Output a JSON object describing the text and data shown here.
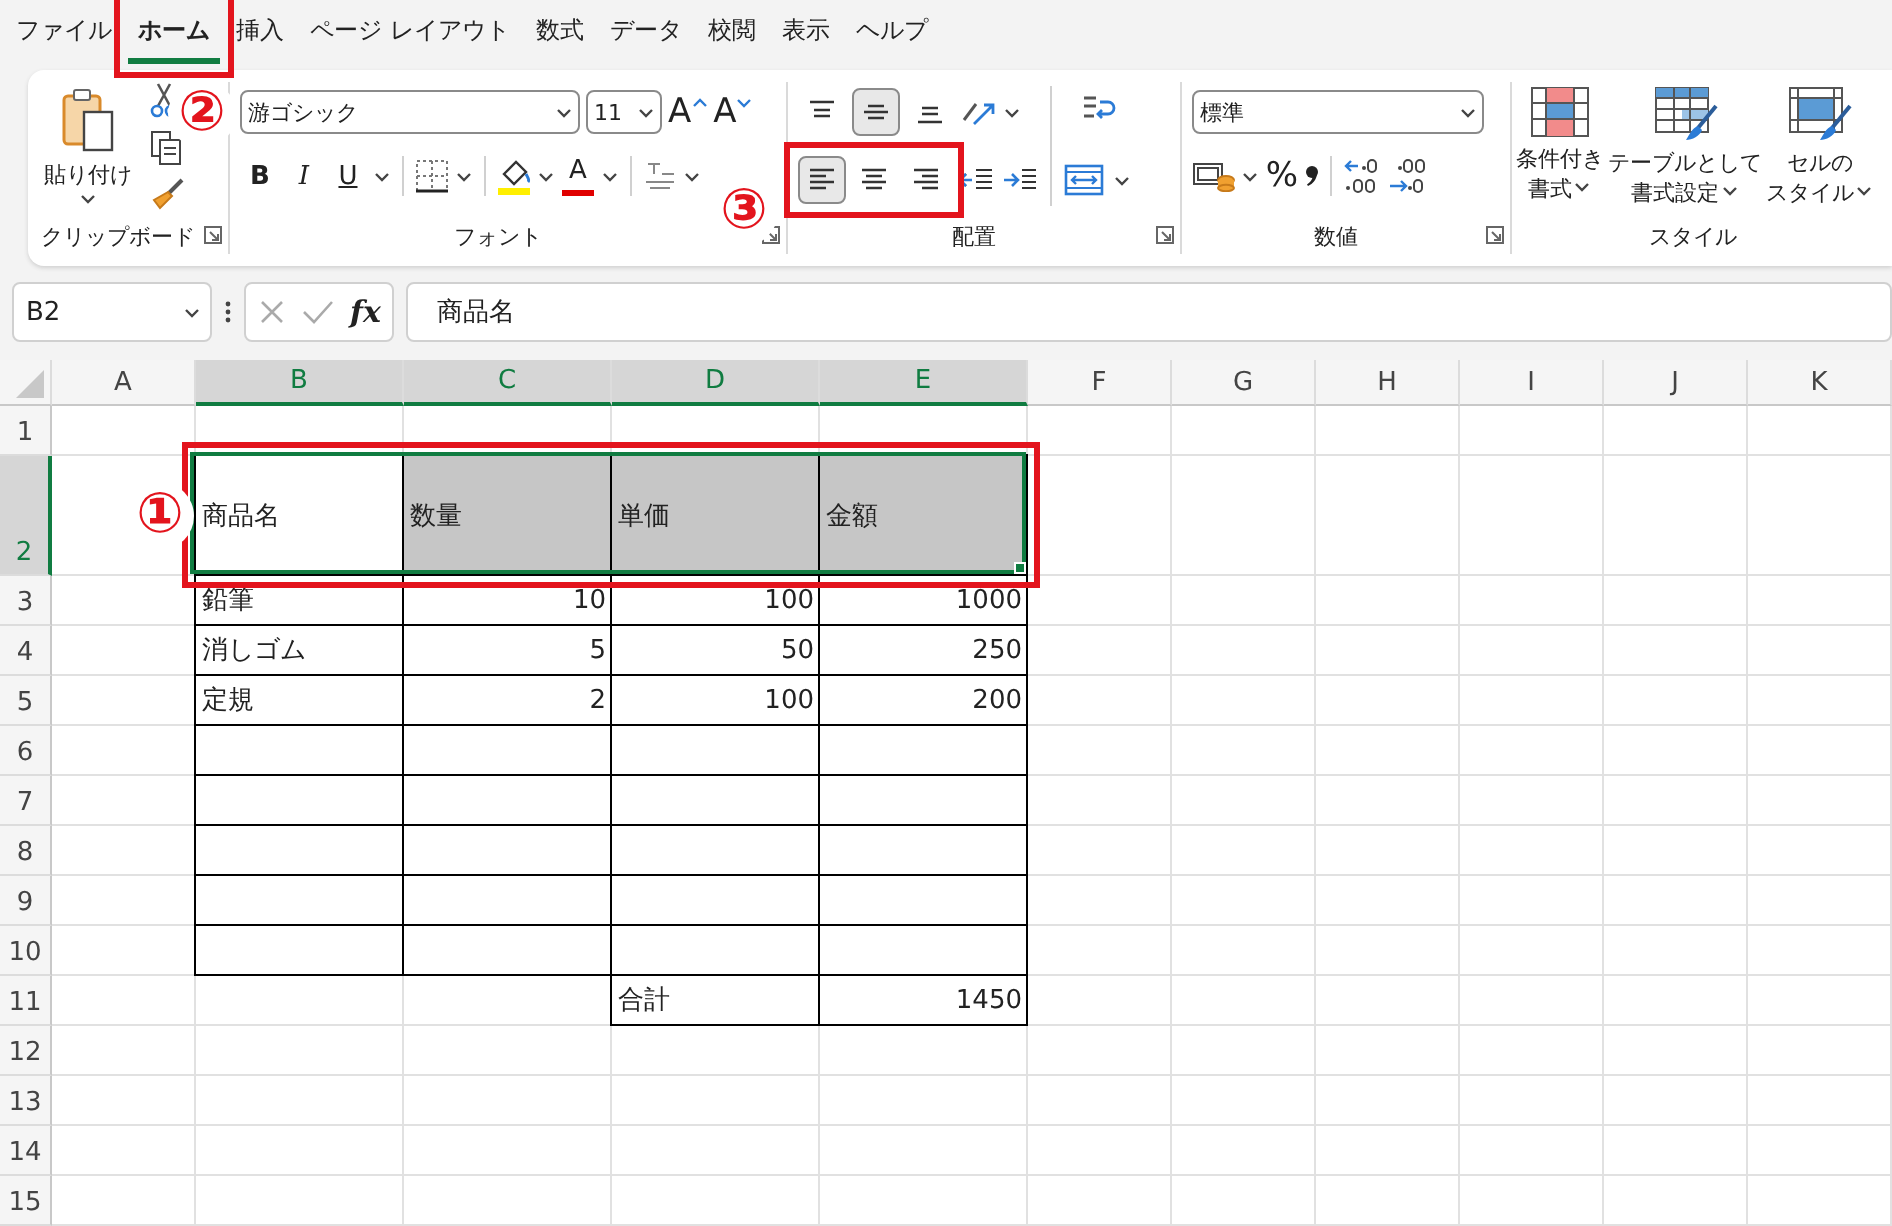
{
  "menu_tabs": [
    {
      "label": "ファイル",
      "selected": false,
      "boxed": false
    },
    {
      "label": "ホーム",
      "selected": true,
      "boxed": true
    },
    {
      "label": "挿入",
      "selected": false,
      "boxed": false
    },
    {
      "label": "ページ レイアウト",
      "selected": false,
      "boxed": false
    },
    {
      "label": "数式",
      "selected": false,
      "boxed": false
    },
    {
      "label": "データ",
      "selected": false,
      "boxed": false
    },
    {
      "label": "校閲",
      "selected": false,
      "boxed": false
    },
    {
      "label": "表示",
      "selected": false,
      "boxed": false
    },
    {
      "label": "ヘルプ",
      "selected": false,
      "boxed": false
    }
  ],
  "ribbon": {
    "clipboard": {
      "paste_label": "貼り付け",
      "label": "クリップボード"
    },
    "font": {
      "font_name": "游ゴシック",
      "font_size": "11",
      "grow_glyph": "A",
      "shrink_glyph": "A",
      "style_buttons": [
        {
          "kind": "bold",
          "glyph": "B"
        },
        {
          "kind": "italic",
          "glyph": "I"
        },
        {
          "kind": "underline",
          "glyph": "U"
        }
      ],
      "font_color_glyph": "A",
      "label": "フォント"
    },
    "alignment": {
      "vertical": [
        {
          "kind": "top",
          "selected": false
        },
        {
          "kind": "middle",
          "selected": true
        },
        {
          "kind": "bottom",
          "selected": false
        }
      ],
      "horizontal": [
        {
          "kind": "left",
          "selected": true
        },
        {
          "kind": "center",
          "selected": false
        },
        {
          "kind": "right",
          "selected": false
        }
      ],
      "boxed": true,
      "label": "配置"
    },
    "number": {
      "format": "標準",
      "percent": "%",
      "label": "数値"
    },
    "styles": {
      "buttons": [
        {
          "lines": [
            "条件付き",
            "書式"
          ]
        },
        {
          "lines": [
            "テーブルとして",
            "書式設定"
          ]
        },
        {
          "lines": [
            "セルの",
            "スタイル"
          ]
        }
      ],
      "label": "スタイル"
    }
  },
  "formula_bar": {
    "name_box": "B2",
    "fx": "fx",
    "value": "商品名"
  },
  "sheet": {
    "columns": [
      {
        "label": "A",
        "selected": false
      },
      {
        "label": "B",
        "selected": true
      },
      {
        "label": "C",
        "selected": true
      },
      {
        "label": "D",
        "selected": true
      },
      {
        "label": "E",
        "selected": true
      },
      {
        "label": "F",
        "selected": false
      },
      {
        "label": "G",
        "selected": false
      },
      {
        "label": "H",
        "selected": false
      },
      {
        "label": "I",
        "selected": false
      },
      {
        "label": "J",
        "selected": false
      },
      {
        "label": "K",
        "selected": false
      }
    ],
    "rows": [
      {
        "label": "1",
        "selected": false,
        "tall": false,
        "boxed": false
      },
      {
        "label": "2",
        "selected": true,
        "tall": true,
        "boxed": true,
        "cells": [
          null,
          {
            "text": "商品名",
            "kind": "text",
            "border": true,
            "selected": true,
            "active": true
          },
          {
            "text": "数量",
            "kind": "text",
            "border": true,
            "selected": true
          },
          {
            "text": "単価",
            "kind": "text",
            "border": true,
            "selected": true
          },
          {
            "text": "金額",
            "kind": "text",
            "border": true,
            "selected": true
          }
        ]
      },
      {
        "label": "3",
        "selected": false,
        "tall": false,
        "boxed": false,
        "cells": [
          null,
          {
            "text": "鉛筆",
            "kind": "text",
            "border": true,
            "selected": false
          },
          {
            "text": "10",
            "kind": "number",
            "border": true,
            "selected": false
          },
          {
            "text": "100",
            "kind": "number",
            "border": true,
            "selected": false
          },
          {
            "text": "1000",
            "kind": "number",
            "border": true,
            "selected": false
          }
        ]
      },
      {
        "label": "4",
        "selected": false,
        "tall": false,
        "boxed": false,
        "cells": [
          null,
          {
            "text": "消しゴム",
            "kind": "text",
            "border": true,
            "selected": false
          },
          {
            "text": "5",
            "kind": "number",
            "border": true,
            "selected": false
          },
          {
            "text": "50",
            "kind": "number",
            "border": true,
            "selected": false
          },
          {
            "text": "250",
            "kind": "number",
            "border": true,
            "selected": false
          }
        ]
      },
      {
        "label": "5",
        "selected": false,
        "tall": false,
        "boxed": false,
        "cells": [
          null,
          {
            "text": "定規",
            "kind": "text",
            "border": true,
            "selected": false
          },
          {
            "text": "2",
            "kind": "number",
            "border": true,
            "selected": false
          },
          {
            "text": "100",
            "kind": "number",
            "border": true,
            "selected": false
          },
          {
            "text": "200",
            "kind": "number",
            "border": true,
            "selected": false
          }
        ]
      },
      {
        "label": "6",
        "selected": false,
        "tall": false,
        "boxed": false,
        "cells": [
          null,
          {
            "border": true,
            "selected": false
          },
          {
            "border": true,
            "selected": false
          },
          {
            "border": true,
            "selected": false
          },
          {
            "border": true,
            "selected": false
          }
        ]
      },
      {
        "label": "7",
        "selected": false,
        "tall": false,
        "boxed": false,
        "cells": [
          null,
          {
            "border": true,
            "selected": false
          },
          {
            "border": true,
            "selected": false
          },
          {
            "border": true,
            "selected": false
          },
          {
            "border": true,
            "selected": false
          }
        ]
      },
      {
        "label": "8",
        "selected": false,
        "tall": false,
        "boxed": false,
        "cells": [
          null,
          {
            "border": true,
            "selected": false
          },
          {
            "border": true,
            "selected": false
          },
          {
            "border": true,
            "selected": false
          },
          {
            "border": true,
            "selected": false
          }
        ]
      },
      {
        "label": "9",
        "selected": false,
        "tall": false,
        "boxed": false,
        "cells": [
          null,
          {
            "border": true,
            "selected": false
          },
          {
            "border": true,
            "selected": false
          },
          {
            "border": true,
            "selected": false
          },
          {
            "border": true,
            "selected": false
          }
        ]
      },
      {
        "label": "10",
        "selected": false,
        "tall": false,
        "boxed": false,
        "cells": [
          null,
          {
            "border": true,
            "selected": false
          },
          {
            "border": true,
            "selected": false
          },
          {
            "border": true,
            "selected": false
          },
          {
            "border": true,
            "selected": false
          }
        ]
      },
      {
        "label": "11",
        "selected": false,
        "tall": false,
        "boxed": false,
        "cells": [
          null,
          null,
          null,
          {
            "text": "合計",
            "kind": "text",
            "border": true,
            "selected": false
          },
          {
            "text": "1450",
            "kind": "number",
            "border": true,
            "selected": false
          }
        ]
      },
      {
        "label": "12",
        "selected": false,
        "tall": false,
        "boxed": false
      },
      {
        "label": "13",
        "selected": false,
        "tall": false,
        "boxed": false
      },
      {
        "label": "14",
        "selected": false,
        "tall": false,
        "boxed": false
      },
      {
        "label": "15",
        "selected": false,
        "tall": false,
        "boxed": false
      }
    ]
  },
  "callouts": [
    {
      "label": "①"
    },
    {
      "label": "②"
    },
    {
      "label": "③"
    }
  ]
}
